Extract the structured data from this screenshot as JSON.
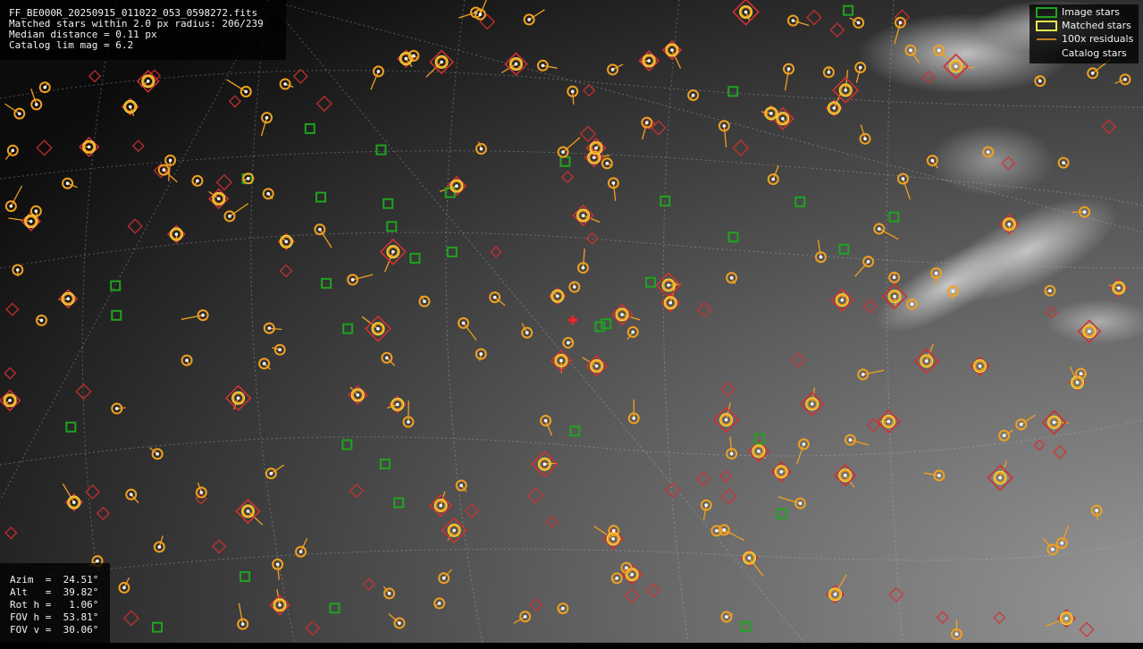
{
  "info": {
    "filename": "FF_BE000R_20250915_011022_053_0598272.fits",
    "matched": "Matched stars within 2.0 px radius: 206/239",
    "median": "Median distance = 0.11 px",
    "catalog": "Catalog lim mag = 6.2"
  },
  "coords": {
    "azim": "Azim  =  24.51°",
    "alt": "Alt   =  39.82°",
    "roth": "Rot h =   1.06°",
    "fovh": "FOV h =  53.81°",
    "fovv": "FOV v =  30.06°"
  },
  "legend": {
    "image_stars": "Image stars",
    "matched_stars": "Matched stars",
    "residuals": "100x residuals",
    "catalog_stars": "Catalog stars"
  },
  "colors": {
    "image_star": "#1fa31f",
    "matched_star": "#e8e84a",
    "residual": "#f0a020",
    "catalog_star": "#d23030",
    "center_marker": "#ff2020"
  }
}
